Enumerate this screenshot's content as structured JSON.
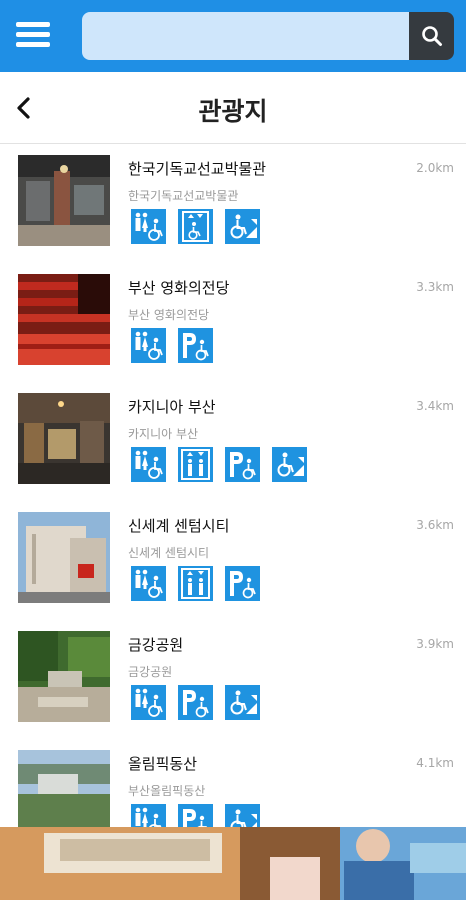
{
  "search": {
    "placeholder": "",
    "value": ""
  },
  "header": {
    "title": "관광지"
  },
  "icon_colors": {
    "accent": "#1f93e0",
    "topbar": "#1f8fe5"
  },
  "items": [
    {
      "name": "한국기독교선교박물관",
      "sub": "한국기독교선교박물관",
      "distance": "2.0km",
      "icons": [
        "restroom-accessible-icon",
        "elevator-wheelchair-icon",
        "ramp-access-icon"
      ]
    },
    {
      "name": "부산 영화의전당",
      "sub": "부산 영화의전당",
      "distance": "3.3km",
      "icons": [
        "restroom-accessible-icon",
        "accessible-parking-icon"
      ]
    },
    {
      "name": "카지니아 부산",
      "sub": "카지니아 부산",
      "distance": "3.4km",
      "icons": [
        "restroom-accessible-icon",
        "elevator-icon",
        "accessible-parking-icon",
        "ramp-access-icon"
      ]
    },
    {
      "name": "신세계 센텀시티",
      "sub": "신세계 센텀시티",
      "distance": "3.6km",
      "icons": [
        "restroom-accessible-icon",
        "elevator-icon",
        "accessible-parking-icon"
      ]
    },
    {
      "name": "금강공원",
      "sub": "금강공원",
      "distance": "3.9km",
      "icons": [
        "restroom-accessible-icon",
        "accessible-parking-icon",
        "ramp-access-icon"
      ]
    },
    {
      "name": "올림픽동산",
      "sub": "부산올림픽동산",
      "distance": "4.1km",
      "icons": [
        "restroom-accessible-icon",
        "accessible-parking-icon",
        "ramp-access-icon"
      ]
    }
  ]
}
